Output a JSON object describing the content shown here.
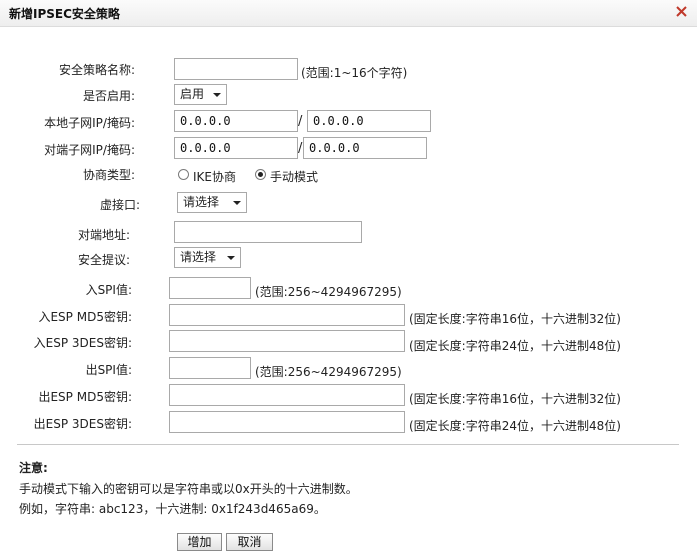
{
  "dialog": {
    "title": "新增IPSEC安全策略"
  },
  "form": {
    "policy_name": {
      "label": "安全策略名称:",
      "value": "",
      "hint": "(范围:1~16个字符)"
    },
    "enable": {
      "label": "是否启用:",
      "value": "启用"
    },
    "local_subnet": {
      "label": "本地子网IP/掩码:",
      "ip": "0.0.0.0",
      "slash": "/",
      "mask": "0.0.0.0"
    },
    "remote_subnet": {
      "label": "对端子网IP/掩码:",
      "ip": "0.0.0.0",
      "slash": "/",
      "mask": "0.0.0.0"
    },
    "negotiation": {
      "label": "协商类型:",
      "option_ike": "IKE协商",
      "option_manual": "手动模式",
      "selected": "手动模式"
    },
    "virtual_interface": {
      "label": "虚接口:",
      "value": "请选择"
    },
    "remote_address": {
      "label": "对端地址:",
      "value": ""
    },
    "security_proposal": {
      "label": "安全提议:",
      "value": "请选择"
    },
    "in_spi": {
      "label": "入SPI值:",
      "value": "",
      "hint": "(范围:256~4294967295)"
    },
    "in_esp_md5": {
      "label": "入ESP MD5密钥:",
      "value": "",
      "hint": "(固定长度:字符串16位，十六进制32位)"
    },
    "in_esp_3des": {
      "label": "入ESP 3DES密钥:",
      "value": "",
      "hint": "(固定长度:字符串24位，十六进制48位)"
    },
    "out_spi": {
      "label": "出SPI值:",
      "value": "",
      "hint": "(范围:256~4294967295)"
    },
    "out_esp_md5": {
      "label": "出ESP MD5密钥:",
      "value": "",
      "hint": "(固定长度:字符串16位，十六进制32位)"
    },
    "out_esp_3des": {
      "label": "出ESP 3DES密钥:",
      "value": "",
      "hint": "(固定长度:字符串24位，十六进制48位)"
    }
  },
  "notes": {
    "heading": "注意:",
    "line1": "手动模式下输入的密钥可以是字符串或以0x开头的十六进制数。",
    "line2": "例如，字符串: abc123，十六进制: 0x1f243d465a69。"
  },
  "buttons": {
    "add": "增加",
    "cancel": "取消"
  }
}
